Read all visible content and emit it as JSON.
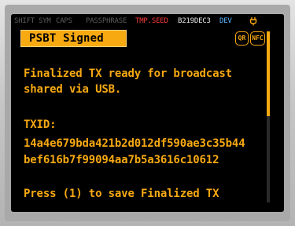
{
  "status_bar": {
    "shift": "SHIFT",
    "sym": "SYM",
    "caps": "CAPS",
    "passphrase": "PASSPHRASE",
    "tmp_seed": "TMP.SEED",
    "fingerprint": "B219DEC3",
    "dev": "DEV",
    "power_icon": "usb-power-icon"
  },
  "header": {
    "title": "PSBT Signed",
    "badges": [
      "QR",
      "NFC"
    ]
  },
  "message": {
    "line1": "Finalized TX ready for broadcast",
    "line2": "shared via USB.",
    "txid_label": "TXID:",
    "txid_line1": "14a4e679bda421b2d012df590ae3c35b44",
    "txid_line2": "bef616b7f99094aa7b5a3616c10612",
    "prompt": "Press (1) to save Finalized TX"
  },
  "scroll": {
    "position_fraction": 0.0,
    "visible_fraction": 0.5
  },
  "colors": {
    "accent": "#f7a912",
    "tmp_seed": "#ff3b3b",
    "dev": "#5fb8ff",
    "background": "#000000"
  }
}
